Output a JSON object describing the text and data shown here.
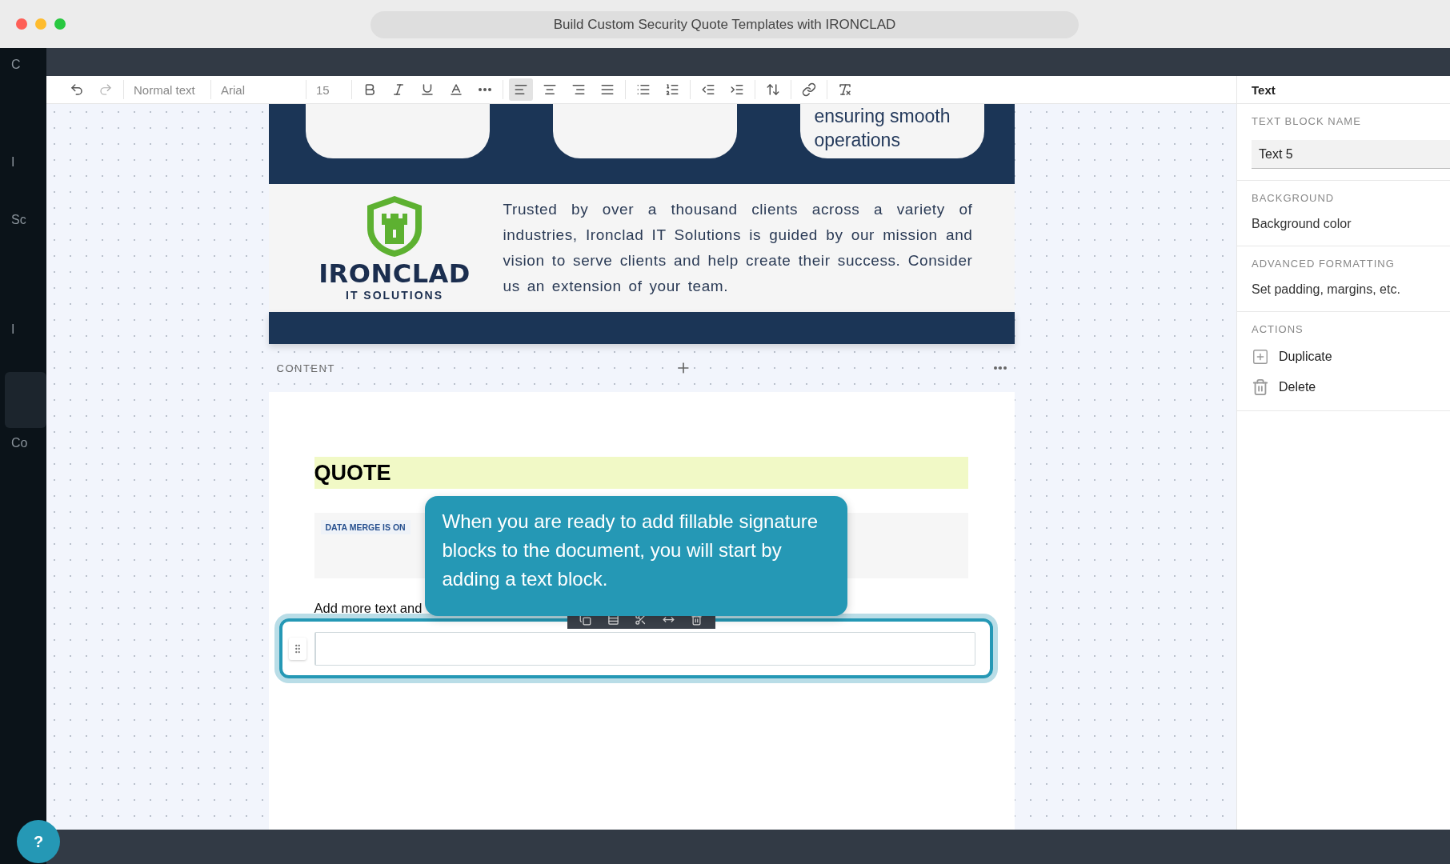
{
  "window": {
    "title": "Build Custom Security Quote Templates with IRONCLAD"
  },
  "left_nav": {
    "items": [
      {
        "label": "C",
        "selected": false
      },
      {
        "label": "I",
        "selected": false
      },
      {
        "label": "Sc",
        "selected": false
      },
      {
        "label": "I",
        "selected": false
      },
      {
        "selected": true
      },
      {
        "label": "Co",
        "selected": false
      }
    ]
  },
  "toolbar": {
    "style": "Normal text",
    "font": "Arial",
    "size": "15",
    "tools": [
      {
        "selected": false
      },
      {
        "selected": false
      },
      {
        "selected": false
      },
      {
        "selected": false
      },
      {
        "selected": false
      },
      {
        "selected": false
      },
      {
        "selected": false
      },
      {
        "selected": true
      },
      {
        "selected": false
      },
      {
        "selected": false
      },
      {
        "selected": false
      },
      {
        "selected": false
      },
      {
        "selected": false
      },
      {
        "selected": false
      },
      {
        "selected": false
      },
      {
        "selected": false
      },
      {
        "selected": false
      },
      {
        "selected": false
      }
    ]
  },
  "banner": {
    "cards": [
      {
        "kind": "blank"
      },
      {
        "kind": "blank"
      },
      {
        "kind": "text",
        "text": "ensuring smooth operations"
      }
    ]
  },
  "brand": {
    "name": "IRONCLAD",
    "tagline": "IT SOLUTIONS"
  },
  "about": "Trusted by over a thousand clients across a variety of industries, Ironclad IT Solutions is guided by our mission and vision to serve clients and help create their success. Consider us an extension of your team.",
  "section_bar": {
    "label": "CONTENT"
  },
  "page": {
    "heading": "QUOTE",
    "merge_badge": "DATA MERGE IS ON",
    "note": "Add more text and",
    "text_block": {
      "selected": true
    }
  },
  "tooltip": {
    "text": "When you are ready to add fillable signature blocks to the document, you will start by adding a text block."
  },
  "panel": {
    "title": "Text",
    "sections": [
      {
        "kind": "field",
        "label": "TEXT BLOCK NAME",
        "value": "Text 5"
      },
      {
        "kind": "link",
        "label": "BACKGROUND",
        "value": "Background color"
      },
      {
        "kind": "link",
        "label": "ADVANCED FORMATTING",
        "value": "Set padding, margins, etc."
      },
      {
        "kind": "actions",
        "label": "ACTIONS",
        "actions": [
          "Duplicate",
          "Delete"
        ]
      }
    ]
  },
  "help": {
    "label": "?"
  }
}
